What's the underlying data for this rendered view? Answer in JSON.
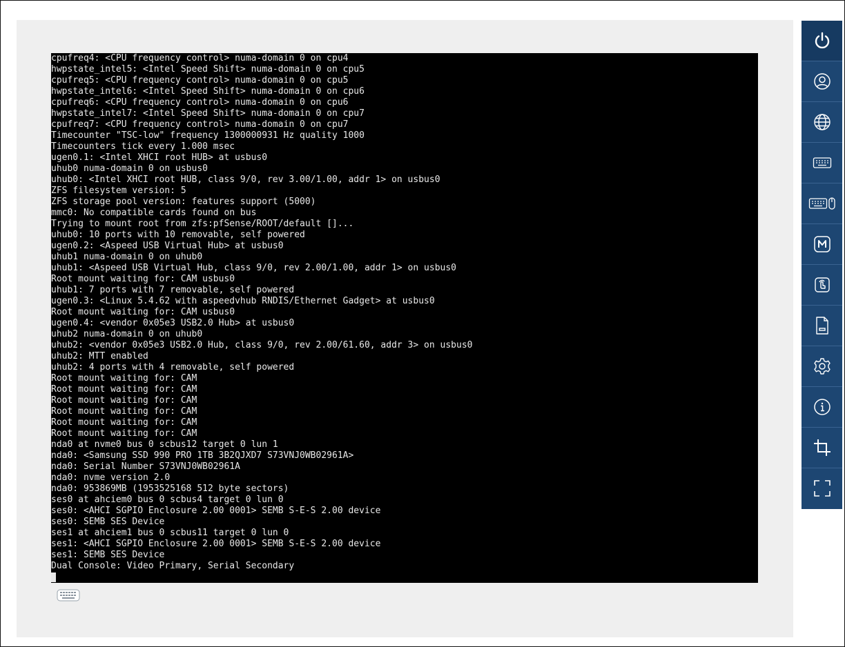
{
  "console": {
    "lines": [
      "cpufreq4: <CPU frequency control> numa-domain 0 on cpu4",
      "hwpstate_intel5: <Intel Speed Shift> numa-domain 0 on cpu5",
      "cpufreq5: <CPU frequency control> numa-domain 0 on cpu5",
      "hwpstate_intel6: <Intel Speed Shift> numa-domain 0 on cpu6",
      "cpufreq6: <CPU frequency control> numa-domain 0 on cpu6",
      "hwpstate_intel7: <Intel Speed Shift> numa-domain 0 on cpu7",
      "cpufreq7: <CPU frequency control> numa-domain 0 on cpu7",
      "Timecounter \"TSC-low\" frequency 1300000931 Hz quality 1000",
      "Timecounters tick every 1.000 msec",
      "ugen0.1: <Intel XHCI root HUB> at usbus0",
      "uhub0 numa-domain 0 on usbus0",
      "uhub0: <Intel XHCI root HUB, class 9/0, rev 3.00/1.00, addr 1> on usbus0",
      "ZFS filesystem version: 5",
      "ZFS storage pool version: features support (5000)",
      "mmc0: No compatible cards found on bus",
      "Trying to mount root from zfs:pfSense/ROOT/default []...",
      "uhub0: 10 ports with 10 removable, self powered",
      "ugen0.2: <Aspeed USB Virtual Hub> at usbus0",
      "uhub1 numa-domain 0 on uhub0",
      "uhub1: <Aspeed USB Virtual Hub, class 9/0, rev 2.00/1.00, addr 1> on usbus0",
      "Root mount waiting for: CAM usbus0",
      "uhub1: 7 ports with 7 removable, self powered",
      "ugen0.3: <Linux 5.4.62 with aspeedvhub RNDIS/Ethernet Gadget> at usbus0",
      "Root mount waiting for: CAM usbus0",
      "ugen0.4: <vendor 0x05e3 USB2.0 Hub> at usbus0",
      "uhub2 numa-domain 0 on uhub0",
      "uhub2: <vendor 0x05e3 USB2.0 Hub, class 9/0, rev 2.00/61.60, addr 3> on usbus0",
      "uhub2: MTT enabled",
      "uhub2: 4 ports with 4 removable, self powered",
      "Root mount waiting for: CAM",
      "Root mount waiting for: CAM",
      "Root mount waiting for: CAM",
      "Root mount waiting for: CAM",
      "Root mount waiting for: CAM",
      "Root mount waiting for: CAM",
      "nda0 at nvme0 bus 0 scbus12 target 0 lun 1",
      "nda0: <Samsung SSD 990 PRO 1TB 3B2QJXD7 S73VNJ0WB02961A>",
      "nda0: Serial Number S73VNJ0WB02961A",
      "nda0: nvme version 2.0",
      "nda0: 953869MB (1953525168 512 byte sectors)",
      "ses0 at ahciem0 bus 0 scbus4 target 0 lun 0",
      "ses0: <AHCI SGPIO Enclosure 2.00 0001> SEMB S-E-S 2.00 device",
      "ses0: SEMB SES Device",
      "ses1 at ahciem1 bus 0 scbus11 target 0 lun 0",
      "ses1: <AHCI SGPIO Enclosure 2.00 0001> SEMB S-E-S 2.00 device",
      "ses1: SEMB SES Device",
      "Dual Console: Video Primary, Serial Secondary"
    ]
  },
  "toolbar": {
    "buttons": [
      {
        "name": "power-button",
        "icon": "power-icon"
      },
      {
        "name": "user-button",
        "icon": "user-icon"
      },
      {
        "name": "language-button",
        "icon": "globe-icon"
      },
      {
        "name": "virtual-keyboard-button",
        "icon": "keyboard-icon"
      },
      {
        "name": "keyboard-mouse-button",
        "icon": "keyboard-mouse-icon"
      },
      {
        "name": "macro-button",
        "icon": "m-icon"
      },
      {
        "name": "send-keys-button",
        "icon": "touch-icon"
      },
      {
        "name": "virtual-media-button",
        "icon": "file-icon"
      },
      {
        "name": "settings-button",
        "icon": "gear-icon"
      },
      {
        "name": "info-button",
        "icon": "info-icon"
      },
      {
        "name": "crop-button",
        "icon": "crop-icon"
      },
      {
        "name": "fullscreen-button",
        "icon": "fullscreen-icon"
      }
    ]
  },
  "colors": {
    "toolbar": "#1d4672",
    "toolbar_active": "#163a61",
    "console_bg": "#000000",
    "console_fg": "#e8e8e8",
    "viewer_bg": "#efefef"
  }
}
